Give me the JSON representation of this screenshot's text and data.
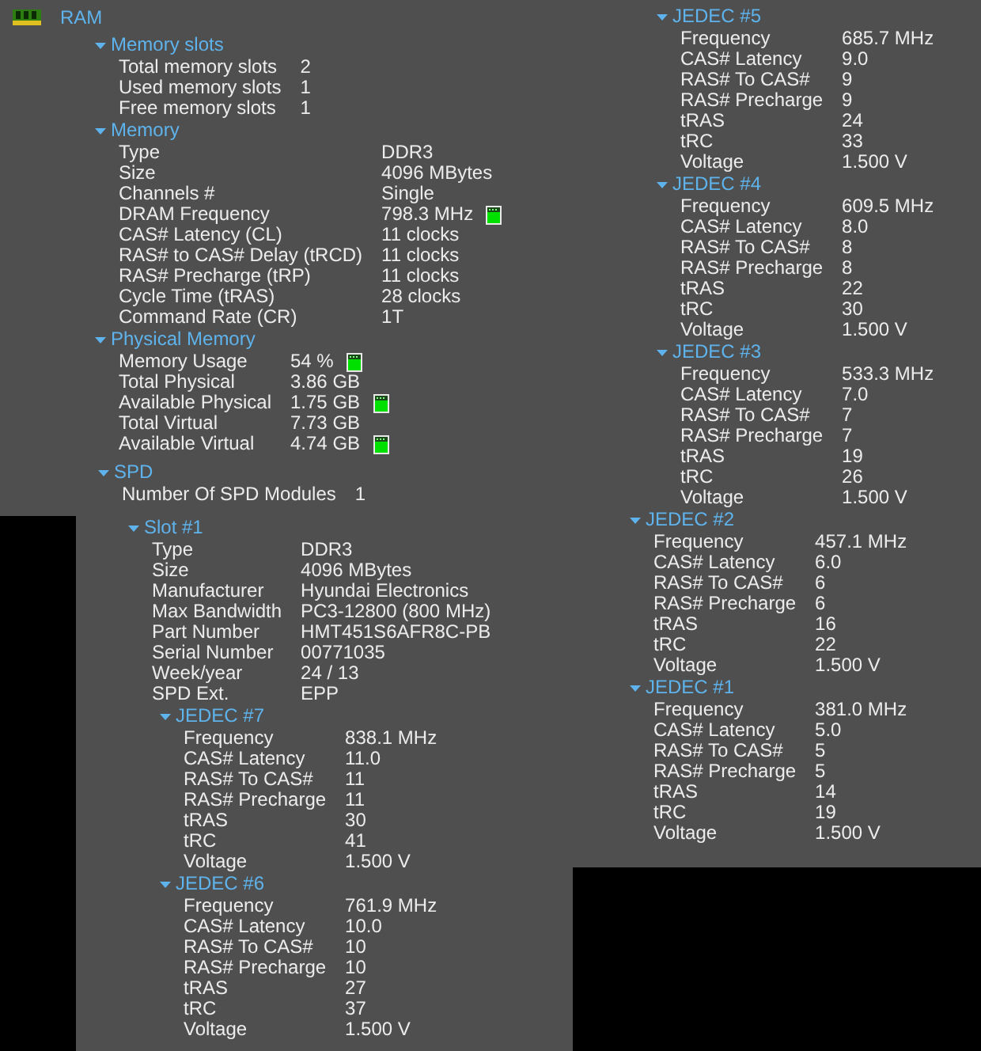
{
  "root": {
    "title": "RAM",
    "children": [
      {
        "title": "Memory slots",
        "expanded": true,
        "rows": [
          {
            "label": "Total memory slots",
            "value": "2"
          },
          {
            "label": "Used memory slots",
            "value": "1"
          },
          {
            "label": "Free memory slots",
            "value": "1"
          }
        ]
      },
      {
        "title": "Memory",
        "expanded": true,
        "rows": [
          {
            "label": "Type",
            "value": "DDR3"
          },
          {
            "label": "Size",
            "value": "4096 MBytes"
          },
          {
            "label": "Channels #",
            "value": "Single"
          },
          {
            "label": "DRAM Frequency",
            "value": "798.3 MHz",
            "kind": "meter"
          },
          {
            "label": "CAS# Latency (CL)",
            "value": "11 clocks"
          },
          {
            "label": "RAS# to CAS# Delay (tRCD)",
            "value": "11 clocks"
          },
          {
            "label": "RAS# Precharge (tRP)",
            "value": "11 clocks"
          },
          {
            "label": "Cycle Time (tRAS)",
            "value": "28 clocks"
          },
          {
            "label": "Command Rate (CR)",
            "value": "1T"
          }
        ]
      },
      {
        "title": "Physical Memory",
        "expanded": true,
        "rows": [
          {
            "label": "Memory Usage",
            "value": "54 %",
            "kind": "meter"
          },
          {
            "label": "Total Physical",
            "value": "3.86 GB"
          },
          {
            "label": "Available Physical",
            "value": "1.75 GB",
            "kind": "meter"
          },
          {
            "label": "Total Virtual",
            "value": "7.73 GB"
          },
          {
            "label": "Available Virtual",
            "value": "4.74 GB",
            "kind": "meter"
          }
        ]
      },
      {
        "title": "SPD",
        "expanded": true,
        "rows": [
          {
            "label": "Number Of SPD Modules",
            "value": "1"
          }
        ],
        "children": [
          {
            "title": "Slot #1",
            "expanded": true,
            "rows": [
              {
                "label": "Type",
                "value": "DDR3"
              },
              {
                "label": "Size",
                "value": "4096 MBytes"
              },
              {
                "label": "Manufacturer",
                "value": "Hyundai Electronics"
              },
              {
                "label": "Max Bandwidth",
                "value": "PC3-12800 (800 MHz)"
              },
              {
                "label": "Part Number",
                "value": "HMT451S6AFR8C-PB"
              },
              {
                "label": "Serial Number",
                "value": "00771035"
              },
              {
                "label": "Week/year",
                "value": "24 / 13"
              },
              {
                "label": "SPD Ext.",
                "value": "EPP"
              }
            ],
            "children": [
              {
                "title": "JEDEC #7",
                "expanded": true,
                "rows": [
                  {
                    "label": "Frequency",
                    "value": "838.1 MHz"
                  },
                  {
                    "label": "CAS# Latency",
                    "value": "11.0"
                  },
                  {
                    "label": "RAS# To CAS#",
                    "value": "11"
                  },
                  {
                    "label": "RAS# Precharge",
                    "value": "11"
                  },
                  {
                    "label": "tRAS",
                    "value": "30"
                  },
                  {
                    "label": "tRC",
                    "value": "41"
                  },
                  {
                    "label": "Voltage",
                    "value": "1.500 V"
                  }
                ]
              },
              {
                "title": "JEDEC #6",
                "expanded": true,
                "rows": [
                  {
                    "label": "Frequency",
                    "value": "761.9 MHz"
                  },
                  {
                    "label": "CAS# Latency",
                    "value": "10.0"
                  },
                  {
                    "label": "RAS# To CAS#",
                    "value": "10"
                  },
                  {
                    "label": "RAS# Precharge",
                    "value": "10"
                  },
                  {
                    "label": "tRAS",
                    "value": "27"
                  },
                  {
                    "label": "tRC",
                    "value": "37"
                  },
                  {
                    "label": "Voltage",
                    "value": "1.500 V"
                  }
                ]
              },
              {
                "title": "JEDEC #5",
                "expanded": true,
                "rows": [
                  {
                    "label": "Frequency",
                    "value": "685.7 MHz"
                  },
                  {
                    "label": "CAS# Latency",
                    "value": "9.0"
                  },
                  {
                    "label": "RAS# To CAS#",
                    "value": "9"
                  },
                  {
                    "label": "RAS# Precharge",
                    "value": "9"
                  },
                  {
                    "label": "tRAS",
                    "value": "24"
                  },
                  {
                    "label": "tRC",
                    "value": "33"
                  },
                  {
                    "label": "Voltage",
                    "value": "1.500 V"
                  }
                ]
              },
              {
                "title": "JEDEC #4",
                "expanded": true,
                "rows": [
                  {
                    "label": "Frequency",
                    "value": "609.5 MHz"
                  },
                  {
                    "label": "CAS# Latency",
                    "value": "8.0"
                  },
                  {
                    "label": "RAS# To CAS#",
                    "value": "8"
                  },
                  {
                    "label": "RAS# Precharge",
                    "value": "8"
                  },
                  {
                    "label": "tRAS",
                    "value": "22"
                  },
                  {
                    "label": "tRC",
                    "value": "30"
                  },
                  {
                    "label": "Voltage",
                    "value": "1.500 V"
                  }
                ]
              },
              {
                "title": "JEDEC #3",
                "expanded": true,
                "rows": [
                  {
                    "label": "Frequency",
                    "value": "533.3 MHz"
                  },
                  {
                    "label": "CAS# Latency",
                    "value": "7.0"
                  },
                  {
                    "label": "RAS# To CAS#",
                    "value": "7"
                  },
                  {
                    "label": "RAS# Precharge",
                    "value": "7"
                  },
                  {
                    "label": "tRAS",
                    "value": "19"
                  },
                  {
                    "label": "tRC",
                    "value": "26"
                  },
                  {
                    "label": "Voltage",
                    "value": "1.500 V"
                  }
                ]
              },
              {
                "title": "JEDEC #2",
                "expanded": true,
                "rows": [
                  {
                    "label": "Frequency",
                    "value": "457.1 MHz"
                  },
                  {
                    "label": "CAS# Latency",
                    "value": "6.0"
                  },
                  {
                    "label": "RAS# To CAS#",
                    "value": "6"
                  },
                  {
                    "label": "RAS# Precharge",
                    "value": "6"
                  },
                  {
                    "label": "tRAS",
                    "value": "16"
                  },
                  {
                    "label": "tRC",
                    "value": "22"
                  },
                  {
                    "label": "Voltage",
                    "value": "1.500 V"
                  }
                ]
              },
              {
                "title": "JEDEC #1",
                "expanded": true,
                "rows": [
                  {
                    "label": "Frequency",
                    "value": "381.0 MHz"
                  },
                  {
                    "label": "CAS# Latency",
                    "value": "5.0"
                  },
                  {
                    "label": "RAS# To CAS#",
                    "value": "5"
                  },
                  {
                    "label": "RAS# Precharge",
                    "value": "5"
                  },
                  {
                    "label": "tRAS",
                    "value": "14"
                  },
                  {
                    "label": "tRC",
                    "value": "19"
                  },
                  {
                    "label": "Voltage",
                    "value": "1.500 V"
                  }
                ]
              }
            ]
          }
        ]
      }
    ]
  }
}
